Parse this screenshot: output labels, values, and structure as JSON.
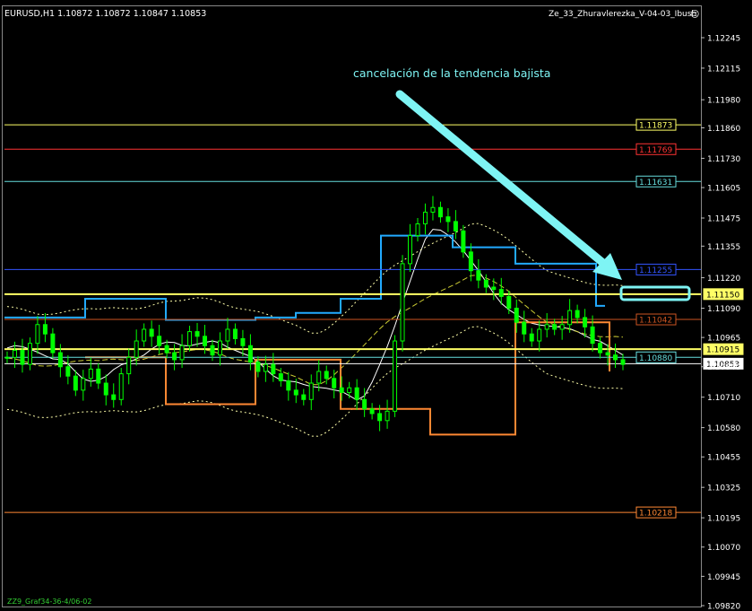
{
  "header": {
    "symbol_line": "EURUSD,H1  1.10872 1.10872 1.10847 1.10853",
    "indicator_name": "Ze_33_Zhuravlerezka_V-04-03_Ibush",
    "smiley": "☺"
  },
  "annotation": {
    "text": "cancelación de la tendencia bajista"
  },
  "footer": {
    "watermark": "ZZ9_Graf34-36-4/06-02"
  },
  "colors": {
    "background": "#000000",
    "candle": "#00ff00",
    "annotation_arrow": "#7ef4f4",
    "annotation_text": "#7ef4f4",
    "level_yellow": "#ffff66",
    "level_red": "#ff3333",
    "level_cyan": "#66dddd",
    "level_blue": "#3355ff",
    "level_brown": "#cc5522",
    "level_white": "#ffffff",
    "level_orange": "#ff8833",
    "step_blue": "#22aaff",
    "step_orange": "#ff8833"
  },
  "chart_data": {
    "type": "candlestick",
    "symbol": "EURUSD",
    "timeframe": "H1",
    "ohlc_header": {
      "open": 1.10872,
      "high": 1.10872,
      "low": 1.10847,
      "close": 1.10853
    },
    "ylim": [
      1.0982,
      1.12245
    ],
    "y_ticks": [
      "1.12245",
      "1.12115",
      "1.11980",
      "1.11860",
      "1.11730",
      "1.11605",
      "1.11475",
      "1.11355",
      "1.11220",
      "1.11090",
      "1.10965",
      "1.10840",
      "1.10710",
      "1.10580",
      "1.10455",
      "1.10325",
      "1.10195",
      "1.10070",
      "1.09945",
      "1.09820"
    ],
    "price_levels": [
      {
        "label": "1.11873",
        "value": 1.11873,
        "color": "#ffff66"
      },
      {
        "label": "1.11769",
        "value": 1.11769,
        "color": "#ff3333"
      },
      {
        "label": "1.11631",
        "value": 1.11631,
        "color": "#66dddd"
      },
      {
        "label": "1.11255",
        "value": 1.11255,
        "color": "#3355ff"
      },
      {
        "label": "1.11150",
        "value": 1.1115,
        "color": "#ffff66"
      },
      {
        "label": "1.11042",
        "value": 1.11042,
        "color": "#cc5522"
      },
      {
        "label": "1.10915",
        "value": 1.10915,
        "color": "#ffff66"
      },
      {
        "label": "1.10880",
        "value": 1.1088,
        "color": "#66dddd"
      },
      {
        "label": "1.10853",
        "value": 1.10853,
        "color": "#ffffff"
      },
      {
        "label": "1.10218",
        "value": 1.10218,
        "color": "#ff8833"
      }
    ],
    "close_series": [
      1.1088,
      1.1091,
      1.1085,
      1.1094,
      1.1102,
      1.1098,
      1.109,
      1.1084,
      1.108,
      1.1074,
      1.1079,
      1.1083,
      1.1077,
      1.1072,
      1.107,
      1.1081,
      1.1088,
      1.1095,
      1.11,
      1.1097,
      1.1093,
      1.109,
      1.1087,
      1.1093,
      1.1099,
      1.1097,
      1.1093,
      1.1089,
      1.1095,
      1.11,
      1.1096,
      1.1093,
      1.1086,
      1.1082,
      1.1085,
      1.1081,
      1.1078,
      1.1074,
      1.1072,
      1.107,
      1.1077,
      1.1082,
      1.1079,
      1.1075,
      1.1073,
      1.1075,
      1.107,
      1.1066,
      1.1064,
      1.1061,
      1.1065,
      1.1095,
      1.1128,
      1.114,
      1.1145,
      1.115,
      1.1152,
      1.1148,
      1.1146,
      1.1142,
      1.1133,
      1.1125,
      1.1121,
      1.1118,
      1.1117,
      1.1114,
      1.1109,
      1.1103,
      1.1098,
      1.1095,
      1.11,
      1.1102,
      1.11,
      1.1102,
      1.1108,
      1.1105,
      1.1101,
      1.1094,
      1.109,
      1.1089,
      1.1087,
      1.1085
    ]
  }
}
